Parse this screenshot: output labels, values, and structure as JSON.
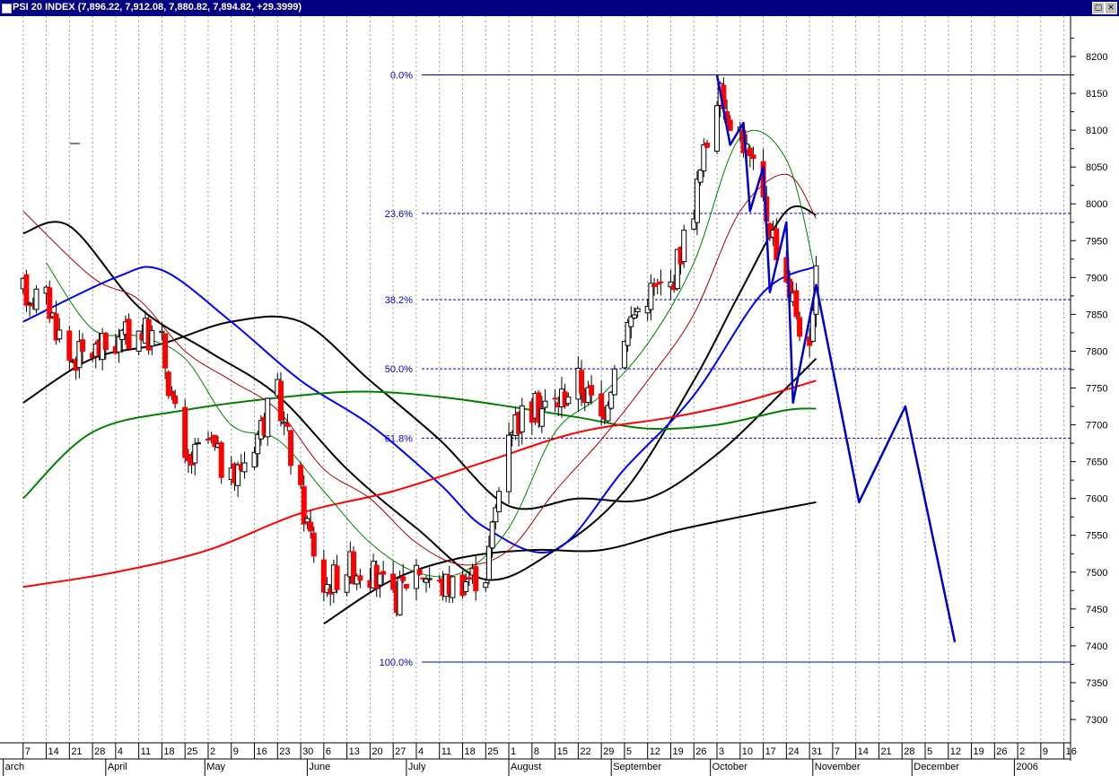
{
  "window": {
    "title_symbol": "PSI 20 INDEX",
    "title_values": "(7,896.22, 7,912.08, 7,880.82, 7,894.82, +29.3999)",
    "restore_icon": "restore-icon",
    "close_icon": "close-icon"
  },
  "colors": {
    "background": "#ffffff",
    "titlebar": "#000080",
    "fib_blue": "#0000cc",
    "bull_candle": "#ffffff",
    "bear_candle": "#ff0000",
    "ma_green_thin": "#008000",
    "ma_red_thin": "#aa0000",
    "ma_black": "#000000",
    "ma_blue": "#0000ff",
    "ma_green": "#008000",
    "ma_red": "#ff0000",
    "grid": "#999999"
  },
  "chart_data": {
    "type": "candlestick",
    "title": "PSI 20 INDEX",
    "ylim": [
      7280,
      8240
    ],
    "y_ticks": [
      8200,
      8150,
      8100,
      8050,
      8000,
      7950,
      7900,
      7850,
      7800,
      7750,
      7700,
      7650,
      7600,
      7550,
      7500,
      7450,
      7400,
      7350,
      7300
    ],
    "x_start": "2005-03-07",
    "x_end": "2006-01-16",
    "grid": "vertical dotted weekly",
    "x_day_ticks": [
      "7",
      "14",
      "21",
      "28",
      "4",
      "11",
      "18",
      "25",
      "2",
      "9",
      "16",
      "23",
      "30",
      "6",
      "13",
      "20",
      "27",
      "4",
      "11",
      "18",
      "25",
      "1",
      "8",
      "15",
      "22",
      "29",
      "5",
      "12",
      "19",
      "26",
      "3",
      "10",
      "17",
      "24",
      "31",
      "7",
      "14",
      "21",
      "28",
      "5",
      "12",
      "19",
      "26",
      "2",
      "9",
      "16"
    ],
    "x_month_labels": [
      {
        "label": "arch",
        "date": "2005-03-01"
      },
      {
        "label": "April",
        "date": "2005-04-01"
      },
      {
        "label": "May",
        "date": "2005-05-01"
      },
      {
        "label": "June",
        "date": "2005-06-01"
      },
      {
        "label": "July",
        "date": "2005-07-01"
      },
      {
        "label": "August",
        "date": "2005-08-01"
      },
      {
        "label": "September",
        "date": "2005-09-01"
      },
      {
        "label": "October",
        "date": "2005-10-01"
      },
      {
        "label": "November",
        "date": "2005-11-01"
      },
      {
        "label": "December",
        "date": "2005-12-01"
      },
      {
        "label": "2006",
        "date": "2006-01-01"
      }
    ],
    "fibonacci": [
      {
        "label": "0.0%",
        "value": 8175
      },
      {
        "label": "23.6%",
        "value": 7987
      },
      {
        "label": "38.2%",
        "value": 7870
      },
      {
        "label": "50.0%",
        "value": 7776
      },
      {
        "label": "61.8%",
        "value": 7682
      },
      {
        "label": "100.0%",
        "value": 7378
      }
    ],
    "fib_anchor_date": "2005-07-04",
    "candle_trend": [
      [
        "2005-03-07",
        7880
      ],
      [
        "2005-03-14",
        7870
      ],
      [
        "2005-03-21",
        7790
      ],
      [
        "2005-03-28",
        7800
      ],
      [
        "2005-04-04",
        7810
      ],
      [
        "2005-04-11",
        7830
      ],
      [
        "2005-04-18",
        7810
      ],
      [
        "2005-04-25",
        7640
      ],
      [
        "2005-05-02",
        7680
      ],
      [
        "2005-05-09",
        7620
      ],
      [
        "2005-05-16",
        7680
      ],
      [
        "2005-05-23",
        7740
      ],
      [
        "2005-05-30",
        7600
      ],
      [
        "2005-06-06",
        7480
      ],
      [
        "2005-06-13",
        7510
      ],
      [
        "2005-06-20",
        7500
      ],
      [
        "2005-06-27",
        7460
      ],
      [
        "2005-07-04",
        7510
      ],
      [
        "2005-07-11",
        7480
      ],
      [
        "2005-07-18",
        7490
      ],
      [
        "2005-07-25",
        7500
      ],
      [
        "2005-08-01",
        7700
      ],
      [
        "2005-08-08",
        7720
      ],
      [
        "2005-08-15",
        7730
      ],
      [
        "2005-08-22",
        7760
      ],
      [
        "2005-08-29",
        7710
      ],
      [
        "2005-09-05",
        7830
      ],
      [
        "2005-09-12",
        7880
      ],
      [
        "2005-09-19",
        7890
      ],
      [
        "2005-09-26",
        8000
      ],
      [
        "2005-10-03",
        8150
      ],
      [
        "2005-10-10",
        8100
      ],
      [
        "2005-10-17",
        8000
      ],
      [
        "2005-10-24",
        7900
      ],
      [
        "2005-10-31",
        7790
      ],
      [
        "2005-11-02",
        7895
      ]
    ],
    "series": [
      {
        "color": "#000000",
        "width": 2,
        "points": [
          [
            "2005-03-07",
            7730
          ],
          [
            "2005-03-28",
            7790
          ],
          [
            "2005-04-18",
            7810
          ],
          [
            "2005-05-09",
            7840
          ],
          [
            "2005-05-30",
            7840
          ],
          [
            "2005-06-20",
            7760
          ],
          [
            "2005-07-11",
            7680
          ],
          [
            "2005-08-01",
            7590
          ],
          [
            "2005-08-22",
            7600
          ],
          [
            "2005-09-12",
            7600
          ],
          [
            "2005-10-03",
            7660
          ],
          [
            "2005-10-24",
            7750
          ],
          [
            "2005-11-02",
            7790
          ]
        ]
      },
      {
        "color": "#000000",
        "width": 2,
        "points": [
          [
            "2005-03-07",
            7960
          ],
          [
            "2005-03-21",
            7970
          ],
          [
            "2005-04-11",
            7860
          ],
          [
            "2005-05-02",
            7800
          ],
          [
            "2005-05-23",
            7740
          ],
          [
            "2005-06-13",
            7640
          ],
          [
            "2005-07-04",
            7560
          ],
          [
            "2005-07-25",
            7490
          ],
          [
            "2005-08-15",
            7530
          ],
          [
            "2005-09-05",
            7610
          ],
          [
            "2005-09-26",
            7760
          ],
          [
            "2005-10-10",
            7880
          ],
          [
            "2005-10-24",
            7990
          ],
          [
            "2005-11-02",
            7985
          ]
        ]
      },
      {
        "color": "#0000ff",
        "width": 2,
        "points": [
          [
            "2005-03-07",
            7840
          ],
          [
            "2005-04-04",
            7900
          ],
          [
            "2005-04-18",
            7910
          ],
          [
            "2005-05-09",
            7840
          ],
          [
            "2005-05-30",
            7760
          ],
          [
            "2005-06-20",
            7700
          ],
          [
            "2005-07-11",
            7620
          ],
          [
            "2005-07-25",
            7560
          ],
          [
            "2005-08-15",
            7530
          ],
          [
            "2005-09-05",
            7640
          ],
          [
            "2005-09-26",
            7740
          ],
          [
            "2005-10-17",
            7880
          ],
          [
            "2005-11-02",
            7915
          ]
        ]
      },
      {
        "color": "#008000",
        "width": 2,
        "points": [
          [
            "2005-03-07",
            7600
          ],
          [
            "2005-03-28",
            7690
          ],
          [
            "2005-04-25",
            7720
          ],
          [
            "2005-05-30",
            7740
          ],
          [
            "2005-06-20",
            7745
          ],
          [
            "2005-07-11",
            7738
          ],
          [
            "2005-08-01",
            7725
          ],
          [
            "2005-08-22",
            7710
          ],
          [
            "2005-09-12",
            7695
          ],
          [
            "2005-10-03",
            7700
          ],
          [
            "2005-10-24",
            7720
          ],
          [
            "2005-11-02",
            7722
          ]
        ]
      },
      {
        "color": "#ff0000",
        "width": 2,
        "points": [
          [
            "2005-03-07",
            7480
          ],
          [
            "2005-04-04",
            7500
          ],
          [
            "2005-05-02",
            7530
          ],
          [
            "2005-05-30",
            7580
          ],
          [
            "2005-06-27",
            7610
          ],
          [
            "2005-07-25",
            7650
          ],
          [
            "2005-08-22",
            7690
          ],
          [
            "2005-09-19",
            7710
          ],
          [
            "2005-10-10",
            7730
          ],
          [
            "2005-11-02",
            7760
          ]
        ]
      },
      {
        "color": "#000000",
        "width": 2,
        "points": [
          [
            "2005-06-06",
            7430
          ],
          [
            "2005-06-27",
            7490
          ],
          [
            "2005-07-18",
            7520
          ],
          [
            "2005-08-08",
            7530
          ],
          [
            "2005-08-29",
            7530
          ],
          [
            "2005-09-19",
            7555
          ],
          [
            "2005-10-10",
            7575
          ],
          [
            "2005-11-02",
            7595
          ]
        ]
      },
      {
        "color": "#008000",
        "width": 1,
        "points": [
          [
            "2005-03-14",
            7920
          ],
          [
            "2005-03-28",
            7830
          ],
          [
            "2005-04-11",
            7820
          ],
          [
            "2005-04-25",
            7790
          ],
          [
            "2005-05-09",
            7700
          ],
          [
            "2005-05-23",
            7680
          ],
          [
            "2005-06-06",
            7610
          ],
          [
            "2005-06-20",
            7540
          ],
          [
            "2005-07-04",
            7500
          ],
          [
            "2005-07-18",
            7500
          ],
          [
            "2005-08-01",
            7560
          ],
          [
            "2005-08-15",
            7690
          ],
          [
            "2005-08-29",
            7740
          ],
          [
            "2005-09-12",
            7810
          ],
          [
            "2005-09-26",
            7920
          ],
          [
            "2005-10-10",
            8090
          ],
          [
            "2005-10-24",
            8060
          ],
          [
            "2005-11-02",
            7900
          ]
        ]
      },
      {
        "color": "#aa0000",
        "width": 1,
        "points": [
          [
            "2005-03-07",
            7990
          ],
          [
            "2005-03-28",
            7900
          ],
          [
            "2005-04-11",
            7870
          ],
          [
            "2005-04-25",
            7800
          ],
          [
            "2005-05-09",
            7760
          ],
          [
            "2005-05-23",
            7720
          ],
          [
            "2005-06-06",
            7640
          ],
          [
            "2005-06-20",
            7600
          ],
          [
            "2005-07-04",
            7540
          ],
          [
            "2005-07-18",
            7510
          ],
          [
            "2005-08-01",
            7530
          ],
          [
            "2005-08-15",
            7610
          ],
          [
            "2005-08-29",
            7680
          ],
          [
            "2005-09-12",
            7760
          ],
          [
            "2005-09-26",
            7850
          ],
          [
            "2005-10-10",
            7990
          ],
          [
            "2005-10-24",
            8040
          ],
          [
            "2005-11-02",
            7980
          ]
        ]
      }
    ],
    "projection": {
      "color": "#0000cc",
      "points": [
        [
          "2005-10-03",
          8175
        ],
        [
          "2005-10-07",
          8080
        ],
        [
          "2005-10-11",
          8110
        ],
        [
          "2005-10-13",
          7990
        ],
        [
          "2005-10-17",
          8050
        ],
        [
          "2005-10-19",
          7880
        ],
        [
          "2005-10-24",
          7975
        ],
        [
          "2005-10-26",
          7730
        ],
        [
          "2005-11-02",
          7890
        ],
        [
          "2005-11-15",
          7595
        ],
        [
          "2005-11-29",
          7725
        ],
        [
          "2005-12-14",
          7405
        ]
      ]
    }
  }
}
